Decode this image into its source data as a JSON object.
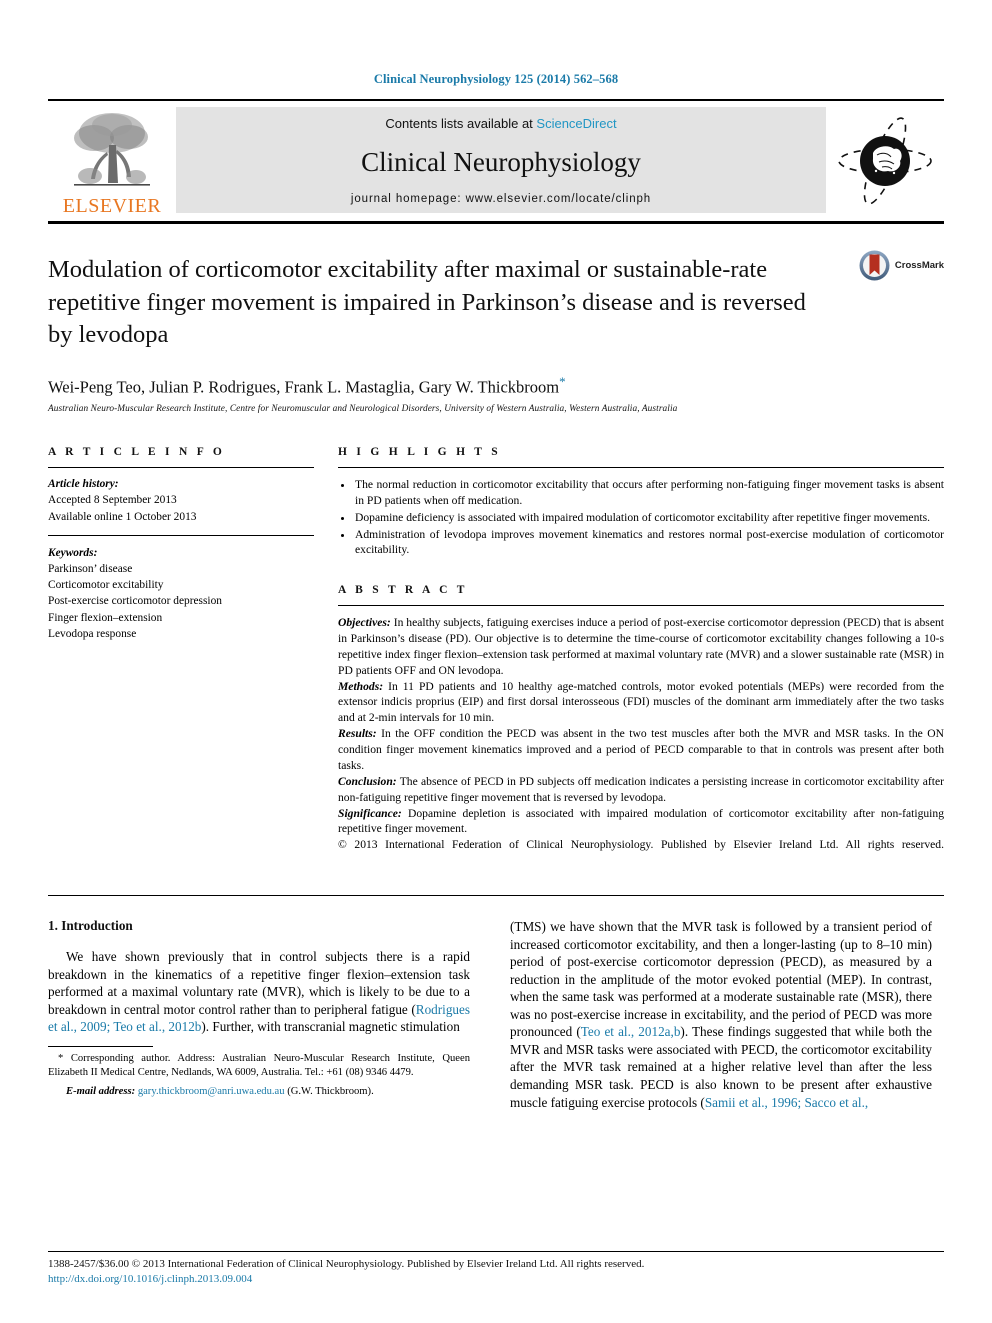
{
  "running_head": "Clinical Neurophysiology 125 (2014) 562–568",
  "masthead": {
    "publisher_wordmark": "ELSEVIER",
    "contents_prefix": "Contents lists available at ",
    "contents_link": "ScienceDirect",
    "journal_name": "Clinical Neurophysiology",
    "journal_homepage": "journal homepage: www.elsevier.com/locate/clinph"
  },
  "article": {
    "title": "Modulation of corticomotor excitability after maximal or sustainable-rate repetitive finger movement is impaired in Parkinson’s disease and is reversed by levodopa",
    "crossmark_label": "CrossMark",
    "authors": "Wei-Peng Teo, Julian P. Rodrigues, Frank L. Mastaglia, Gary W. Thickbroom",
    "corresponding_marker": "*",
    "affiliation": "Australian Neuro-Muscular Research Institute, Centre for Neuromuscular and Neurological Disorders, University of Western Australia, Western Australia, Australia"
  },
  "article_info": {
    "heading": "A R T I C L E   I N F O",
    "history_label": "Article history:",
    "history": [
      "Accepted 8 September 2013",
      "Available online 1 October 2013"
    ],
    "keywords_label": "Keywords:",
    "keywords": [
      "Parkinson’ disease",
      "Corticomotor excitability",
      "Post-exercise corticomotor depression",
      "Finger flexion–extension",
      "Levodopa response"
    ]
  },
  "highlights": {
    "heading": "H I G H L I G H T S",
    "items": [
      "The normal reduction in corticomotor excitability that occurs after performing non-fatiguing finger movement tasks is absent in PD patients when off medication.",
      "Dopamine deficiency is associated with impaired modulation of corticomotor excitability after repetitive finger movements.",
      "Administration of levodopa improves movement kinematics and restores normal post-exercise modulation of corticomotor excitability."
    ]
  },
  "abstract": {
    "heading": "A B S T R A C T",
    "sections": [
      {
        "label": "Objectives:",
        "text": " In healthy subjects, fatiguing exercises induce a period of post-exercise corticomotor depression (PECD) that is absent in Parkinson’s disease (PD). Our objective is to determine the time-course of corticomotor excitability changes following a 10-s repetitive index finger flexion–extension task performed at maximal voluntary rate (MVR) and a slower sustainable rate (MSR) in PD patients OFF and ON levodopa."
      },
      {
        "label": "Methods:",
        "text": " In 11 PD patients and 10 healthy age-matched controls, motor evoked potentials (MEPs) were recorded from the extensor indicis proprius (EIP) and first dorsal interosseous (FDI) muscles of the dominant arm immediately after the two tasks and at 2-min intervals for 10 min."
      },
      {
        "label": "Results:",
        "text": " In the OFF condition the PECD was absent in the two test muscles after both the MVR and MSR tasks. In the ON condition finger movement kinematics improved and a period of PECD comparable to that in controls was present after both tasks."
      },
      {
        "label": "Conclusion:",
        "text": " The absence of PECD in PD subjects off medication indicates a persisting increase in corticomotor excitability after non-fatiguing repetitive finger movement that is reversed by levodopa."
      },
      {
        "label": "Significance:",
        "text": " Dopamine depletion is associated with impaired modulation of corticomotor excitability after non-fatiguing repetitive finger movement."
      }
    ],
    "copyright": "© 2013 International Federation of Clinical Neurophysiology. Published by Elsevier Ireland Ltd. All rights reserved."
  },
  "introduction": {
    "section_number_title": "1. Introduction",
    "left_paragraph_part1": "We have shown previously that in control subjects there is a rapid breakdown in the kinematics of a repetitive finger flexion–extension task performed at a maximal voluntary rate (MVR), which is likely to be due to a breakdown in central motor control rather than to peripheral fatigue (",
    "left_citation1": "Rodrigues et al., 2009; Teo et al., 2012b",
    "left_paragraph_part2": "). Further, with transcranial magnetic stimulation ",
    "right_paragraph_part1": "(TMS) we have shown that the MVR task is followed by a transient period of increased corticomotor excitability, and then a longer-lasting (up to 8–10 min) period of post-exercise corticomotor depression (PECD), as measured by a reduction in the amplitude of the motor evoked potential (MEP). In contrast, when the same task was performed at a moderate sustainable rate (MSR), there was no post-exercise increase in excitability, and the period of PECD was more pronounced (",
    "right_citation1": "Teo et al., 2012a,b",
    "right_paragraph_part2": "). These findings suggested that while both the MVR and MSR tasks were associated with PECD, the corticomotor excitability after the MVR task remained at a higher relative level than after the less demanding MSR task. PECD is also known to be present after exhaustive muscle fatiguing exercise protocols (",
    "right_citation2": "Samii et al., 1996; Sacco et al.,"
  },
  "footnote": {
    "marker": "*",
    "corresponding": " Corresponding author. Address: Australian Neuro-Muscular Research Institute, Queen Elizabeth II Medical Centre, Nedlands, WA 6009, Australia. Tel.: +61 (08) 9346 4479.",
    "email_label": "E-mail address:",
    "email": "gary.thickbroom@anri.uwa.edu.au",
    "email_suffix": " (G.W. Thickbroom)."
  },
  "page_footer": {
    "issn_line": "1388-2457/$36.00 © 2013 International Federation of Clinical Neurophysiology. Published by Elsevier Ireland Ltd. All rights reserved.",
    "doi": "http://dx.doi.org/10.1016/j.clinph.2013.09.004"
  },
  "colors": {
    "link_blue": "#1a7aa8",
    "sciencedirect_blue": "#2196c4",
    "elsevier_orange": "#E87722",
    "banner_gray": "#e3e3e3",
    "crossmark_red": "#b52f20"
  }
}
